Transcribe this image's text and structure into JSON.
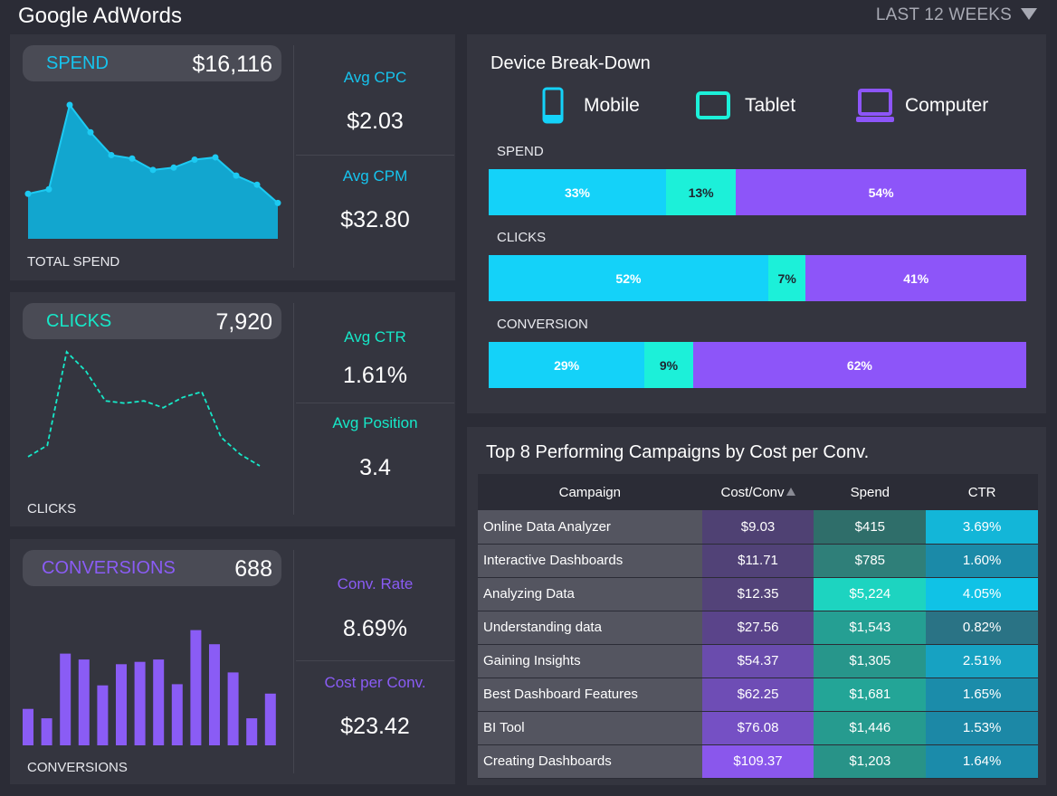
{
  "header": {
    "title": "Google AdWords",
    "period": "LAST 12 WEEKS",
    "period_icon": "caret-down-icon"
  },
  "spend_panel": {
    "label": "SPEND",
    "value": "$16,116",
    "caption": "TOTAL SPEND",
    "stats": [
      {
        "label": "Avg CPC",
        "value": "$2.03"
      },
      {
        "label": "Avg CPM",
        "value": "$32.80"
      }
    ],
    "color": "#16c4ee",
    "trend": [
      22,
      26,
      100,
      76,
      56,
      53,
      43,
      45,
      52,
      54,
      38,
      30,
      14
    ]
  },
  "clicks_panel": {
    "label": "CLICKS",
    "value": "7,920",
    "caption": "CLICKS",
    "stats": [
      {
        "label": "Avg CTR",
        "value": "1.61%"
      },
      {
        "label": "Avg Position",
        "value": "3.4"
      }
    ],
    "color": "#16e8c8",
    "trend": [
      8,
      18,
      100,
      83,
      57,
      55,
      57,
      51,
      60,
      65,
      25,
      10,
      0
    ]
  },
  "conversions_panel": {
    "label": "CONVERSIONS",
    "value": "688",
    "caption": "CONVERSIONS",
    "stats": [
      {
        "label": "Conv. Rate",
        "value": "8.69%"
      },
      {
        "label": "Cost per Conv.",
        "value": "23.42"
      }
    ],
    "color": "#8a5cf5",
    "bars": [
      31,
      23,
      78,
      73,
      51,
      69,
      71,
      73,
      52,
      98,
      86,
      62,
      23,
      44
    ]
  },
  "device_breakdown": {
    "title": "Device Break-Down",
    "legend": [
      {
        "label": "Mobile",
        "icon": "mobile-phone-icon",
        "color": "#14d2f9"
      },
      {
        "label": "Tablet",
        "icon": "tablet-icon",
        "color": "#1cf0d9"
      },
      {
        "label": "Computer",
        "icon": "computer-laptop-icon",
        "color": "#8d55f9"
      }
    ],
    "rows": [
      {
        "label": "SPEND",
        "mobile": 33,
        "tablet": 13,
        "computer": 54,
        "mobile_text": "33%",
        "tablet_text": "13%",
        "computer_text": "54%"
      },
      {
        "label": "CLICKS",
        "mobile": 52,
        "tablet": 7,
        "computer": 41,
        "mobile_text": "52%",
        "tablet_text": "7%",
        "computer_text": "41%"
      },
      {
        "label": "CONVERSION",
        "mobile": 29,
        "tablet": 9,
        "computer": 62,
        "mobile_text": "29%",
        "tablet_text": "9%",
        "computer_text": "62%"
      }
    ]
  },
  "campaigns": {
    "title": "Top 8 Performing Campaigns by Cost per Conv.",
    "columns": [
      "Campaign",
      "Cost/Conv",
      "Spend",
      "CTR"
    ],
    "sort_icon": "sort-ascending-icon",
    "rows": [
      {
        "name": "Online Data Analyzer",
        "cost": "$9.03",
        "spend": "$415",
        "ctr": "3.69%",
        "cost_bg": "#4f4173",
        "spend_bg": "#2f6e6a",
        "ctr_bg": "#13b6d8"
      },
      {
        "name": "Interactive Dashboards",
        "cost": "$11.71",
        "spend": "$785",
        "ctr": "1.60%",
        "cost_bg": "#514277",
        "spend_bg": "#2f7f79",
        "ctr_bg": "#1b8aa8"
      },
      {
        "name": "Analyzing Data",
        "cost": "$12.35",
        "spend": "$5,224",
        "ctr": "4.05%",
        "cost_bg": "#534379",
        "spend_bg": "#1dd4c0",
        "ctr_bg": "#10c2e6"
      },
      {
        "name": "Understanding data",
        "cost": "$27.56",
        "spend": "$1,543",
        "ctr": "0.82%",
        "cost_bg": "#5a448a",
        "spend_bg": "#259f93",
        "ctr_bg": "#2a7385"
      },
      {
        "name": "Gaining Insights",
        "cost": "$54.37",
        "spend": "$1,305",
        "ctr": "2.51%",
        "cost_bg": "#6a4cad",
        "spend_bg": "#27968b",
        "ctr_bg": "#17a2c2"
      },
      {
        "name": "Best Dashboard Features",
        "cost": "$62.25",
        "spend": "$1,681",
        "ctr": "1.65%",
        "cost_bg": "#6e4db5",
        "spend_bg": "#23a597",
        "ctr_bg": "#1b8caa"
      },
      {
        "name": "BI Tool",
        "cost": "$76.08",
        "spend": "$1,446",
        "ctr": "1.53%",
        "cost_bg": "#7550c4",
        "spend_bg": "#269b8f",
        "ctr_bg": "#1c88a6"
      },
      {
        "name": "Creating Dashboards",
        "cost": "$109.37",
        "spend": "$1,203",
        "ctr": "1.64%",
        "cost_bg": "#8a57ec",
        "spend_bg": "#289388",
        "ctr_bg": "#1b8baa"
      }
    ]
  }
}
